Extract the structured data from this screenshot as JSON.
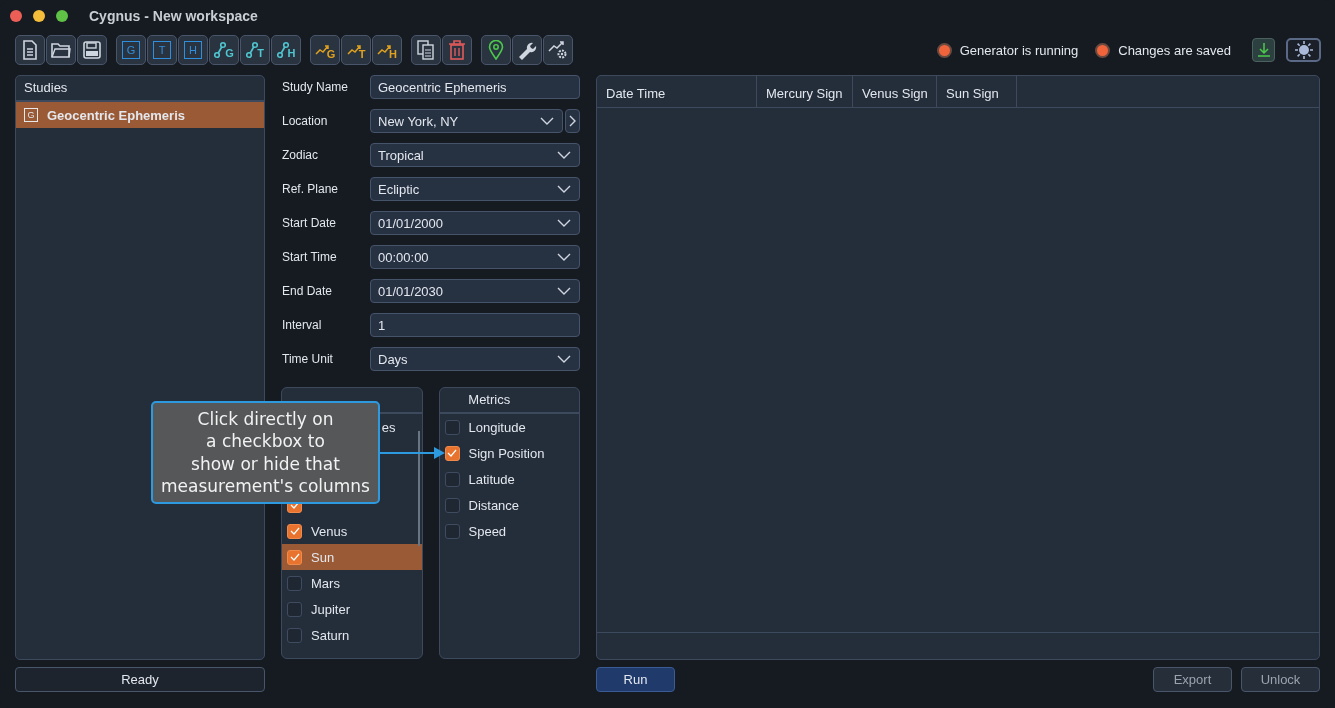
{
  "window": {
    "title": "Cygnus - New workspace"
  },
  "toolbar": [
    [
      {
        "kind": "document"
      },
      {
        "kind": "folder"
      },
      {
        "kind": "save"
      }
    ],
    [
      {
        "kind": "letterbox",
        "letter": "G"
      },
      {
        "kind": "letterbox",
        "letter": "T"
      },
      {
        "kind": "letterbox",
        "letter": "H"
      },
      {
        "kind": "node",
        "letter": "G"
      },
      {
        "kind": "node",
        "letter": "T"
      },
      {
        "kind": "node",
        "letter": "H"
      }
    ],
    [
      {
        "kind": "chart",
        "letter": "G"
      },
      {
        "kind": "chart",
        "letter": "T"
      },
      {
        "kind": "chart",
        "letter": "H"
      }
    ],
    [
      {
        "kind": "copy"
      },
      {
        "kind": "trash"
      }
    ],
    [
      {
        "kind": "pin"
      },
      {
        "kind": "wrench"
      },
      {
        "kind": "chartgear"
      }
    ]
  ],
  "status": [
    {
      "label": "Generator is running",
      "color": "#f0643c"
    },
    {
      "label": "Changes are saved",
      "color": "#f0643c"
    }
  ],
  "studies": {
    "title": "Studies",
    "items": [
      {
        "letter": "G",
        "label": "Geocentric Ephemeris",
        "selected": true
      }
    ]
  },
  "form": [
    {
      "label": "Study Name",
      "kind": "text",
      "value": "Geocentric Ephemeris"
    },
    {
      "label": "Location",
      "kind": "select-go",
      "value": "New York, NY"
    },
    {
      "label": "Zodiac",
      "kind": "select",
      "value": "Tropical"
    },
    {
      "label": "Ref. Plane",
      "kind": "select",
      "value": "Ecliptic"
    },
    {
      "label": "Start Date",
      "kind": "select",
      "value": "01/01/2000"
    },
    {
      "label": "Start Time",
      "kind": "select",
      "value": "00:00:00"
    },
    {
      "label": "End Date",
      "kind": "select",
      "value": "01/01/2030"
    },
    {
      "label": "Interval",
      "kind": "text",
      "value": "1"
    },
    {
      "label": "Time Unit",
      "kind": "select",
      "value": "Days"
    }
  ],
  "bodies": {
    "items": [
      {
        "label": "es",
        "kind": "partial"
      },
      {
        "kind": "body",
        "checked": true,
        "selected": false
      },
      {
        "label": "Venus",
        "kind": "body",
        "checked": true,
        "selected": false
      },
      {
        "label": "Sun",
        "kind": "body",
        "checked": true,
        "selected": true
      },
      {
        "label": "Mars",
        "kind": "body",
        "checked": false,
        "selected": false
      },
      {
        "label": "Jupiter",
        "kind": "body",
        "checked": false,
        "selected": false
      },
      {
        "label": "Saturn",
        "kind": "body",
        "checked": false,
        "selected": false
      }
    ]
  },
  "metrics": {
    "title": "Metrics",
    "items": [
      {
        "label": "Longitude",
        "checked": false
      },
      {
        "label": "Sign Position",
        "checked": true
      },
      {
        "label": "Latitude",
        "checked": false
      },
      {
        "label": "Distance",
        "checked": false
      },
      {
        "label": "Speed",
        "checked": false
      }
    ]
  },
  "table": {
    "columns": [
      "Date Time",
      "Mercury Sign",
      "Venus Sign",
      "Sun Sign"
    ]
  },
  "tooltip": {
    "text": "Click directly on\na checkbox to\nshow or hide that\nmeasurement's columns"
  },
  "status_bar": {
    "text": "Ready"
  },
  "buttons": {
    "run": "Run",
    "export": "Export",
    "unlock": "Unlock"
  }
}
